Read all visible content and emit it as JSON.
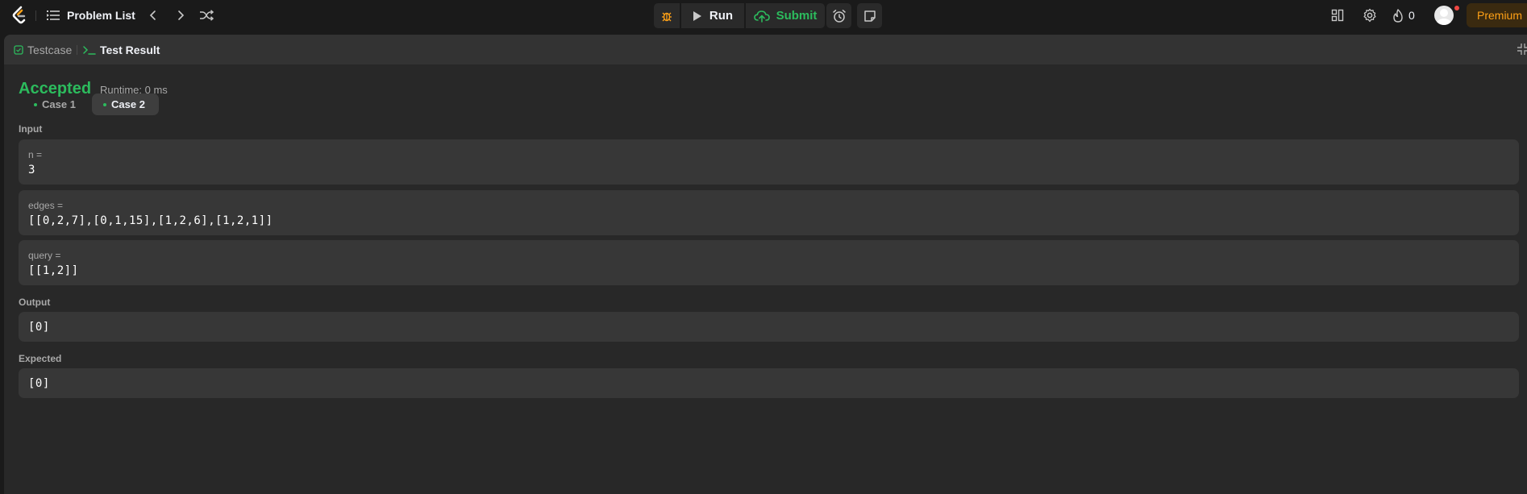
{
  "nav": {
    "problem_list_label": "Problem List",
    "run_label": "Run",
    "submit_label": "Submit",
    "streak_count": "0",
    "premium_label": "Premium"
  },
  "colors": {
    "accent_green": "#2cbb5d",
    "premium_orange": "#ffa116",
    "logo_orange": "#ffa116"
  },
  "icons": [
    "leetcode-logo-icon",
    "list-icon",
    "chevron-left-icon",
    "chevron-right-icon",
    "shuffle-icon",
    "debug-icon",
    "play-icon",
    "cloud-upload-icon",
    "alarm-clock-icon",
    "note-icon",
    "layout-grid-icon",
    "gear-icon",
    "fire-icon",
    "checkbox-icon",
    "terminal-icon",
    "collapse-icon"
  ],
  "panel": {
    "tabs": [
      {
        "label": "Testcase"
      },
      {
        "label": "Test Result"
      }
    ],
    "status": "Accepted",
    "runtime": "Runtime: 0 ms",
    "cases": [
      {
        "label": "Case 1"
      },
      {
        "label": "Case 2"
      }
    ],
    "input_label": "Input",
    "inputs": [
      {
        "name": "n =",
        "value": "3"
      },
      {
        "name": "edges =",
        "value": "[[0,2,7],[0,1,15],[1,2,6],[1,2,1]]"
      },
      {
        "name": "query =",
        "value": "[[1,2]]"
      }
    ],
    "output_label": "Output",
    "output_value": "[0]",
    "expected_label": "Expected",
    "expected_value": "[0]"
  }
}
